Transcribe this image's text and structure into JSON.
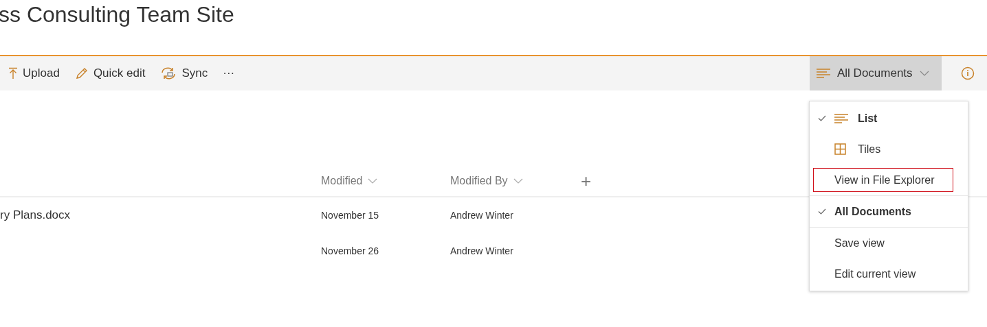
{
  "site_title": "ss Consulting Team Site",
  "commands": [
    {
      "kind": "upload",
      "label": "Upload"
    },
    {
      "kind": "edit",
      "label": "Quick edit"
    },
    {
      "kind": "sync",
      "label": "Sync"
    },
    {
      "kind": "more",
      "label": "···"
    }
  ],
  "view_button": {
    "label": "All Documents",
    "expanded": true
  },
  "table": {
    "columns": [
      "Modified",
      "Modified By"
    ],
    "add_column": "+",
    "rows": [
      {
        "name": "ry Plans.docx",
        "modified": "November 15",
        "modified_by": "Andrew Winter"
      },
      {
        "modified": "November 26",
        "modified_by": "Andrew Winter"
      }
    ]
  },
  "view_menu": {
    "items": [
      {
        "kind": "list",
        "label": "List",
        "checked": true,
        "highlighted": false
      },
      {
        "kind": "tiles",
        "label": "Tiles",
        "checked": false,
        "highlighted": false
      },
      {
        "kind": "action",
        "label": "View in File Explorer",
        "highlighted": true
      },
      {
        "kind": "divider"
      },
      {
        "kind": "saved",
        "label": "All Documents",
        "checked": true
      },
      {
        "kind": "divider"
      },
      {
        "kind": "action",
        "label": "Save view",
        "highlighted": false
      },
      {
        "kind": "action",
        "label": "Edit current view",
        "highlighted": false
      }
    ]
  }
}
